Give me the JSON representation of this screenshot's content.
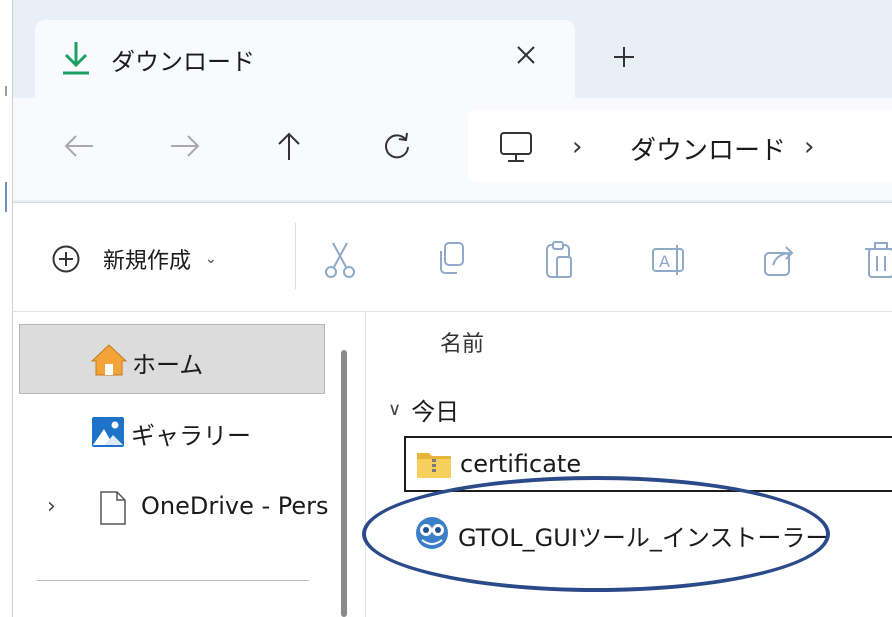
{
  "tab": {
    "title": "ダウンロード",
    "icon": "download-icon",
    "close_icon": "close-icon"
  },
  "new_tab_icon": "plus-icon",
  "nav": {
    "back_icon": "arrow-left-icon",
    "forward_icon": "arrow-right-icon",
    "up_icon": "arrow-up-icon",
    "refresh_icon": "refresh-icon"
  },
  "address": {
    "root_icon": "pc-icon",
    "separator": "›",
    "crumb": "ダウンロード"
  },
  "commandbar": {
    "new_label": "新規作成",
    "new_caret": "⌄",
    "icons": [
      "cut-icon",
      "copy-icon",
      "paste-icon",
      "rename-icon",
      "share-icon",
      "delete-icon"
    ]
  },
  "sidebar": {
    "items": [
      {
        "label": "ホーム",
        "icon": "home-icon",
        "selected": true
      },
      {
        "label": "ギャラリー",
        "icon": "gallery-icon"
      },
      {
        "label": "OneDrive - Perso",
        "icon": "document-icon",
        "expander": "›"
      }
    ]
  },
  "content": {
    "column_name": "名前",
    "group": {
      "label": "今日",
      "chevron": "∨"
    },
    "files": [
      {
        "name": "certificate",
        "icon": "zip-folder-icon"
      },
      {
        "name": "GTOL_GUIツール_インストーラー",
        "icon": "installer-app-icon"
      }
    ]
  },
  "colors": {
    "accent_green": "#1d9e62",
    "highlight_blue": "#2b4a8a",
    "titlebar_bg": "#e9eff7"
  }
}
